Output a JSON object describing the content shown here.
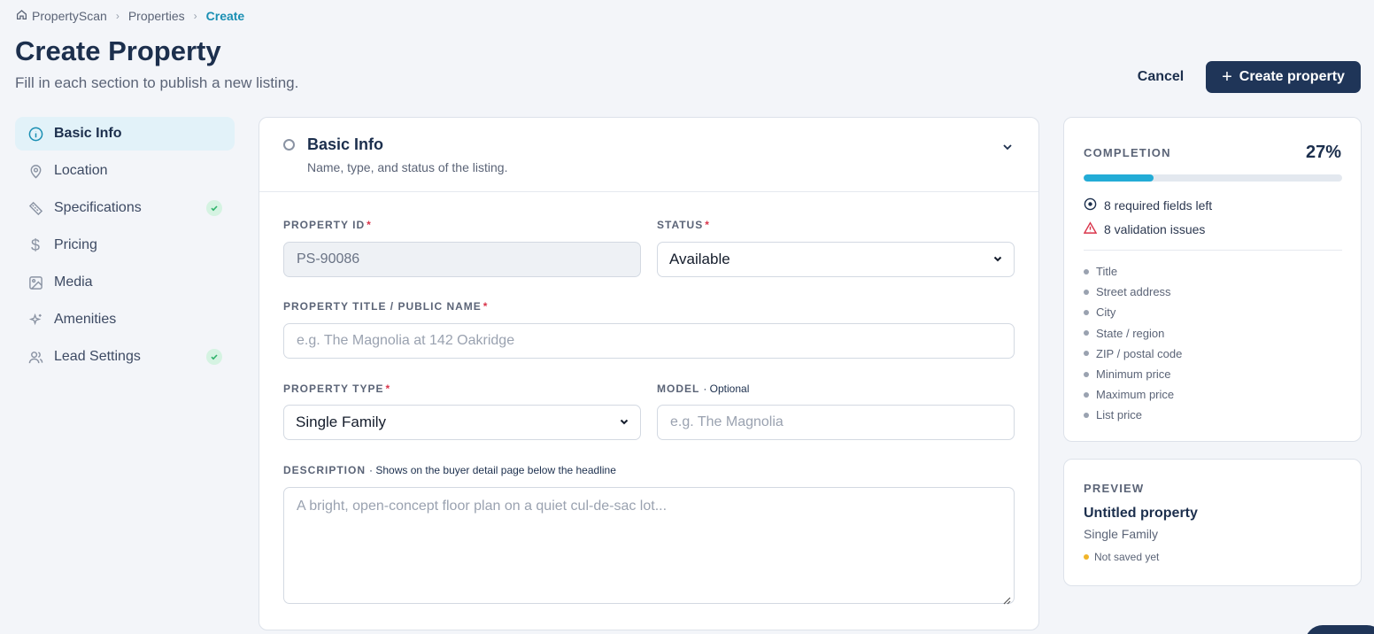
{
  "breadcrumb": {
    "home": "PropertyScan",
    "properties": "Properties",
    "current": "Create"
  },
  "page": {
    "title": "Create Property",
    "subtitle": "Fill in each section to publish a new listing."
  },
  "actions": {
    "cancel": "Cancel",
    "create": "Create property"
  },
  "sidebar": {
    "items": [
      {
        "label": "Basic Info",
        "icon": "info-icon",
        "active": true,
        "complete": false
      },
      {
        "label": "Location",
        "icon": "map-pin-icon",
        "active": false,
        "complete": false
      },
      {
        "label": "Specifications",
        "icon": "ruler-icon",
        "active": false,
        "complete": true
      },
      {
        "label": "Pricing",
        "icon": "dollar-icon",
        "active": false,
        "complete": false
      },
      {
        "label": "Media",
        "icon": "image-icon",
        "active": false,
        "complete": false
      },
      {
        "label": "Amenities",
        "icon": "sparkles-icon",
        "active": false,
        "complete": false
      },
      {
        "label": "Lead Settings",
        "icon": "users-icon",
        "active": false,
        "complete": true
      }
    ]
  },
  "section": {
    "title": "Basic Info",
    "description": "Name, type, and status of the listing."
  },
  "form": {
    "property_id": {
      "label": "Property ID",
      "value": "PS-90086"
    },
    "status": {
      "label": "Status",
      "value": "Available"
    },
    "title": {
      "label": "Property Title / Public Name",
      "placeholder": "e.g. The Magnolia at 142 Oakridge"
    },
    "type": {
      "label": "Property Type",
      "value": "Single Family"
    },
    "model": {
      "label": "Model",
      "hint": "· Optional",
      "placeholder": "e.g. The Magnolia"
    },
    "description": {
      "label": "Description",
      "hint": "· Shows on the buyer detail page below the headline",
      "placeholder": "A bright, open-concept floor plan on a quiet cul-de-sac lot..."
    }
  },
  "completion": {
    "label": "Completion",
    "percent_text": "27%",
    "progress": 0.27,
    "required_left": "8 required fields left",
    "validation_issues": "8 validation issues",
    "missing": [
      "Title",
      "Street address",
      "City",
      "State / region",
      "ZIP / postal code",
      "Minimum price",
      "Maximum price",
      "List price"
    ]
  },
  "preview": {
    "label": "Preview",
    "title": "Untitled property",
    "type": "Single Family",
    "status": "Not saved yet"
  },
  "colors": {
    "accent": "#23acd6",
    "primary": "#1f3558",
    "success": "#2fb36b",
    "warning": "#f0b429",
    "danger": "#d9344a"
  }
}
